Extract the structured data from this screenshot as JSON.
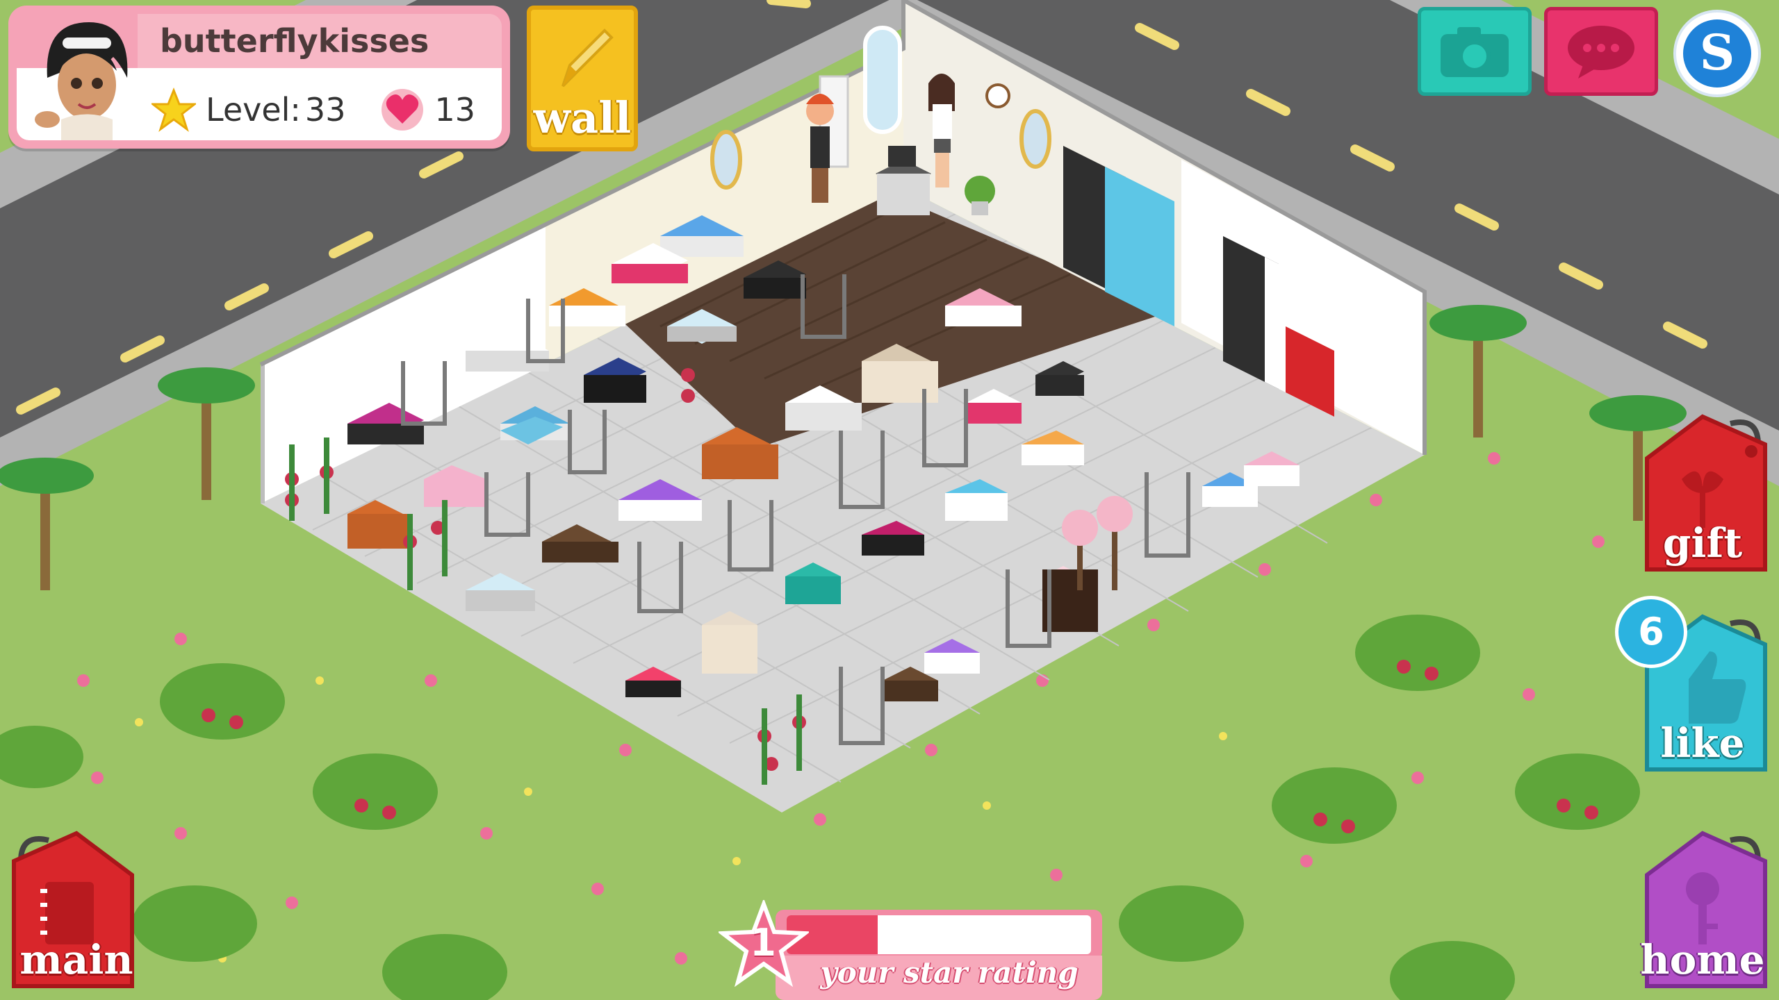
{
  "player": {
    "username": "butterflykisses",
    "level_label": "Level:",
    "level_value": "33",
    "hearts": "13"
  },
  "buttons": {
    "wall_label": "wall",
    "gift_label": "gift",
    "like_label": "like",
    "like_count": "6",
    "home_label": "home",
    "main_label": "main",
    "currency_symbol": "S"
  },
  "rating": {
    "stars": "1",
    "caption": "your star rating",
    "progress": 0.3
  },
  "colors": {
    "grass": "#9cc466",
    "road": "#5f5f60",
    "sidewalk": "#a9a9a9",
    "floor_tile": "#d7d7d7",
    "wood_floor": "#5a4335",
    "profile_pink": "#f5a3b7",
    "wall_yellow": "#f5c120",
    "camera_teal": "#29c9b6",
    "chat_pink": "#e8336c",
    "gift_red": "#d9262b",
    "like_cyan": "#33c3d6",
    "home_purple": "#b14ec6",
    "main_red": "#d9262b"
  },
  "icons": [
    "star-icon",
    "heart-icon",
    "pencil-icon",
    "camera-icon",
    "chat-icon",
    "gift-bow-icon",
    "thumbs-up-icon",
    "key-icon",
    "notebook-icon",
    "rating-star-icon"
  ]
}
